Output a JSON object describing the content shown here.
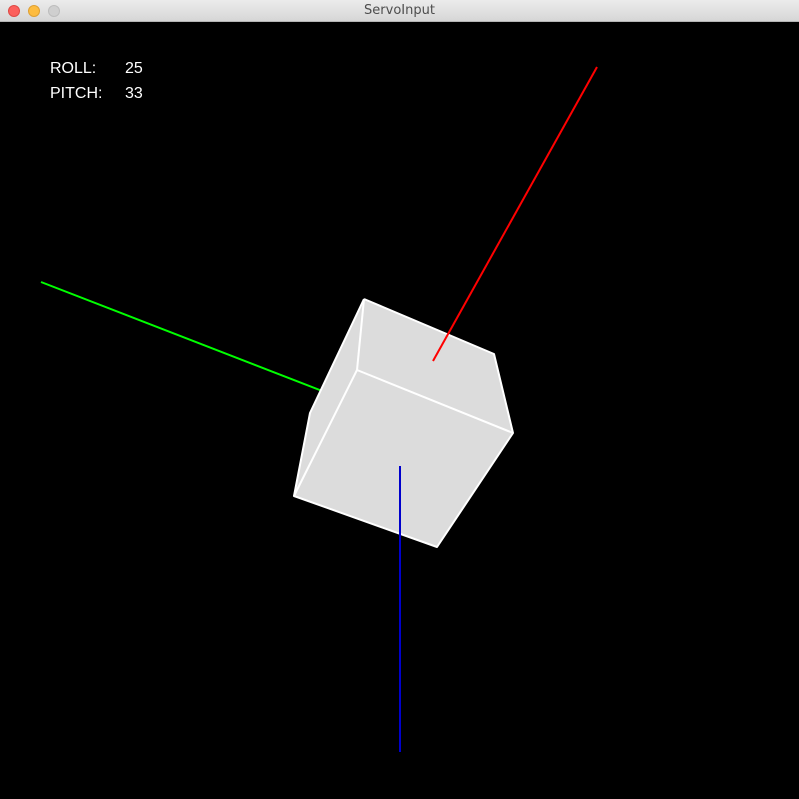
{
  "window": {
    "title": "ServoInput"
  },
  "hud": {
    "roll_label": "ROLL:",
    "roll_value": "25",
    "pitch_label": "PITCH:",
    "pitch_value": "33"
  },
  "scene": {
    "background": "#000000",
    "cube_fill": "#dcdcdc",
    "cube_edge": "#ffffff",
    "axis_x_color": "#ff0000",
    "axis_y_color": "#00ff00",
    "axis_z_color": "#0000cc"
  }
}
